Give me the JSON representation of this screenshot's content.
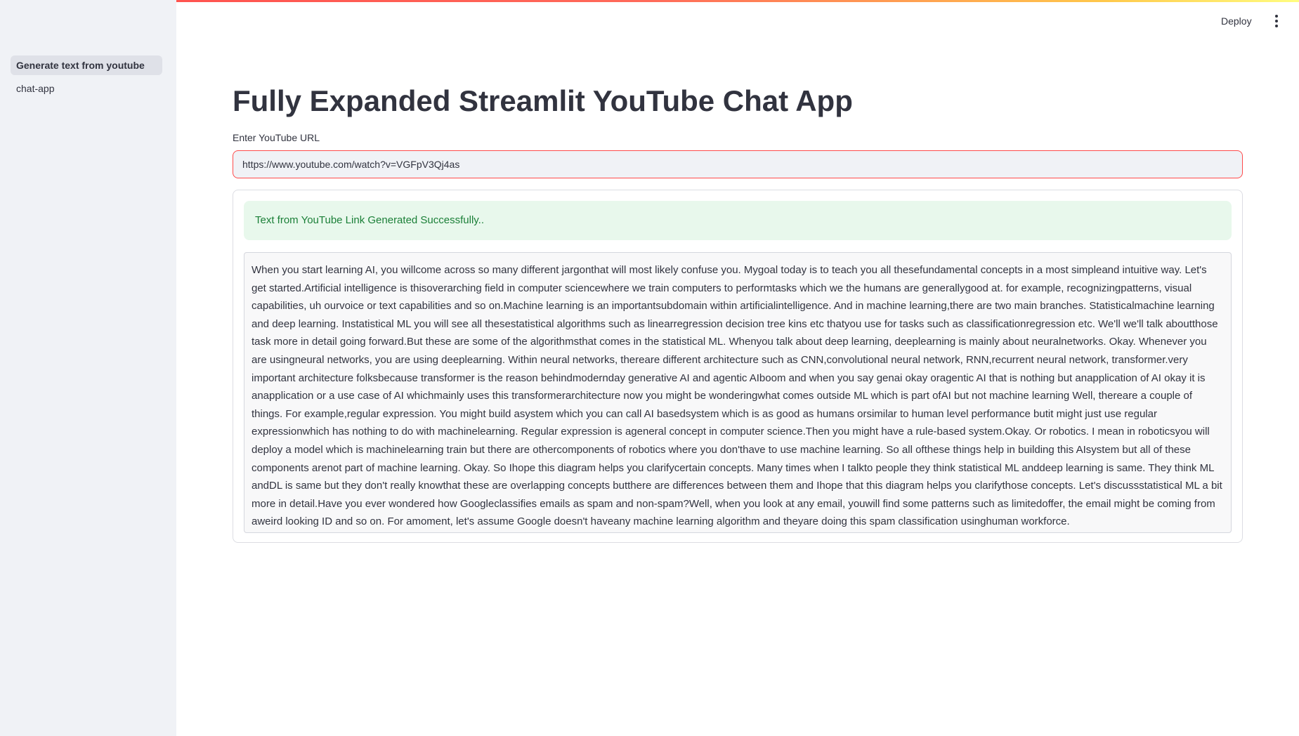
{
  "sidebar": {
    "items": [
      {
        "label": "Generate text from youtube",
        "active": true
      },
      {
        "label": "chat-app",
        "active": false
      }
    ]
  },
  "header": {
    "deploy_label": "Deploy",
    "menu_icon": "vertical-ellipsis-icon"
  },
  "main": {
    "title": "Fully Expanded Streamlit YouTube Chat App",
    "url_label": "Enter YouTube URL",
    "url_value": "https://www.youtube.com/watch?v=VGFpV3Qj4as",
    "success_message": "Text from YouTube Link Generated Successfully..",
    "transcript": "When you start learning AI, you willcome across so many different jargonthat will most likely confuse you. Mygoal today is to teach you all thesefundamental concepts in a most simpleand intuitive way. Let's get started.Artificial intelligence is thisoverarching field in computer sciencewhere we train computers to performtasks which we the humans are generallygood at. for example, recognizingpatterns, visual capabilities, uh ourvoice or text capabilities and so on.Machine learning is an importantsubdomain within artificialintelligence. And in machine learning,there are two main branches. Statisticalmachine learning and deep learning. Instatistical ML you will see all thesestatistical algorithms such as linearregression decision tree kins etc thatyou use for tasks such as classificationregression etc. We'll we'll talk aboutthose task more in detail going forward.But these are some of the algorithmsthat comes in the statistical ML. Whenyou talk about deep learning, deeplearning is mainly about neuralnetworks. Okay. Whenever you are usingneural networks, you are using deeplearning. Within neural networks, thereare different architecture such as CNN,convolutional neural network, RNN,recurrent neural network, transformer.very important architecture folksbecause transformer is the reason behindmodernday generative AI and agentic AIboom and when you say genai okay oragentic AI that is nothing but anapplication of AI okay it is anapplication or a use case of AI whichmainly uses this transformerarchitecture now you might be wonderingwhat comes outside ML which is part ofAI but not machine learning Well, thereare a couple of things. For example,regular expression. You might build asystem which you can call AI basedsystem which is as good as humans orsimilar to human level performance butit might just use regular expressionwhich has nothing to do with machinelearning. Regular expression is ageneral concept in computer science.Then you might have a rule-based system.Okay. Or robotics. I mean in roboticsyou will deploy a model which is machinelearning train but there are othercomponents of robotics where you don'thave to use machine learning. So all ofthese things help in building this AIsystem but all of these components arenot part of machine learning. Okay. So Ihope this diagram helps you clarifycertain concepts. Many times when I talkto people they think statistical ML anddeep learning is same. They think ML andDL is same but they don't really knowthat these are overlapping concepts butthere are differences between them and Ihope that this diagram helps you clarifythose concepts. Let's discussstatistical ML a bit more in detail.Have you ever wondered how Googleclassifies emails as spam and non-spam?Well, when you look at any email, youwill find some patterns such as limitedoffer, the email might be coming from aweird looking ID and so on. For amoment, let's assume Google doesn't haveany machine learning algorithm and theyare doing this spam classification usinghuman workforce."
  }
}
